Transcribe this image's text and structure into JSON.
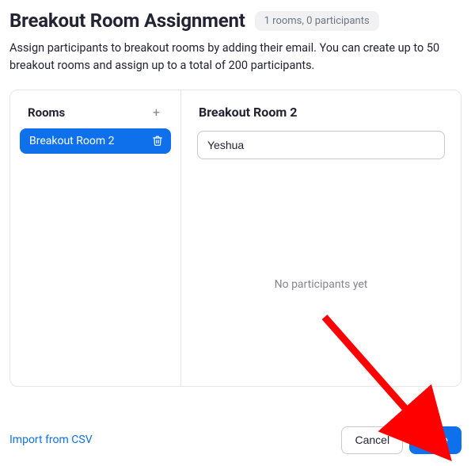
{
  "header": {
    "title": "Breakout Room Assignment",
    "badge": "1 rooms, 0 participants"
  },
  "description": "Assign participants to breakout rooms by adding their email. You can create up to 50 breakout rooms and assign up to a total of 200 participants.",
  "sidebar": {
    "label": "Rooms",
    "rooms": [
      {
        "name": "Breakout Room 2",
        "selected": true
      }
    ]
  },
  "detail": {
    "title": "Breakout Room 2",
    "input_value": "Yeshua",
    "empty_state": "No participants yet"
  },
  "footer": {
    "import_label": "Import from CSV",
    "cancel_label": "Cancel",
    "save_label": "Save"
  }
}
